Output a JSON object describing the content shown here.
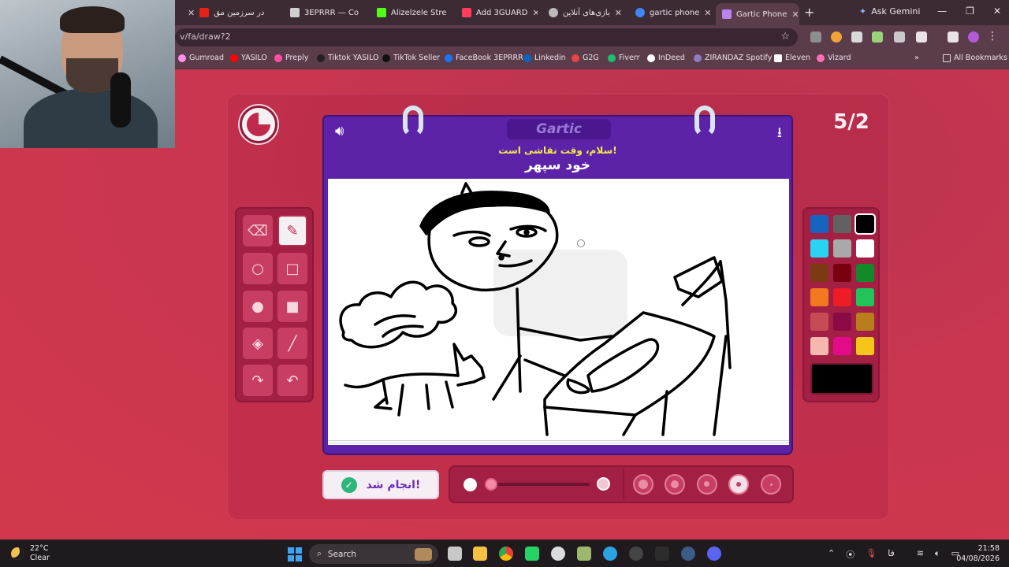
{
  "browser": {
    "tabs": [
      {
        "label": "در سرزمین مق",
        "favicon_color": "#e62117"
      },
      {
        "label": "3EPRRR — Co",
        "favicon_color": "#cfcfcf"
      },
      {
        "label": "Alizelzele Stre",
        "favicon_color": "#53fc18"
      },
      {
        "label": "Add 3GUARD",
        "favicon_color": "#ff3d5a"
      },
      {
        "label": "بازی‌های آنلاین",
        "favicon_color": "#bbbbbb"
      },
      {
        "label": "gartic phone",
        "favicon_color": "#4285f4"
      },
      {
        "label": "Gartic Phone",
        "favicon_color": "#b784f0",
        "active": true
      }
    ],
    "new_tab": "+",
    "ask_gemini": "Ask Gemini",
    "url": "v/fa/draw?2",
    "bookmarks": [
      {
        "label": "Gumroad",
        "color": "#ff90e8"
      },
      {
        "label": "YASILO",
        "color": "#ff0000"
      },
      {
        "label": "Preply",
        "color": "#ff4fa3"
      },
      {
        "label": "Tiktok YASILO",
        "color": "#222222"
      },
      {
        "label": "TikTok Seller",
        "color": "#111111"
      },
      {
        "label": "FaceBook 3EPRRR",
        "color": "#1877f2"
      },
      {
        "label": "Linkedin",
        "color": "#0a66c2"
      },
      {
        "label": "G2G",
        "color": "#e94343"
      },
      {
        "label": "Fiverr",
        "color": "#1dbf73"
      },
      {
        "label": "InDeed",
        "color": "#ffffff"
      },
      {
        "label": "ZIRANDAZ Spotify",
        "color": "#8e7cc3"
      },
      {
        "label": "Eleven",
        "color": "#ffffff"
      },
      {
        "label": "Vizard",
        "color": "#ff6fb5"
      }
    ],
    "all_bookmarks": "All Bookmarks"
  },
  "game": {
    "brand": "Gartic",
    "round": "5/2",
    "prompt_sub": "سلام، وقت نقاشی است!",
    "prompt_main": "خود سپهر",
    "done_label": "انجام شد!",
    "palette": [
      "#1565c0",
      "#616161",
      "#000000",
      "#29d3f2",
      "#a9a9a9",
      "#ffffff",
      "#7a3b12",
      "#7a0010",
      "#128a2a",
      "#f2791f",
      "#ee1c24",
      "#22c45a",
      "#c74b55",
      "#8a0a46",
      "#b97d1c",
      "#f5b7b0",
      "#e40b8a",
      "#f5c518"
    ],
    "selected_color": "#000000",
    "tools": [
      "eraser",
      "pencil",
      "circle-outline",
      "square-outline",
      "circle-filled",
      "square-filled",
      "fill-bucket",
      "line",
      "redo",
      "undo"
    ],
    "active_tool": "pencil"
  },
  "taskbar": {
    "temp": "22°C",
    "condition": "Clear",
    "search": "Search",
    "time": "21:58",
    "date": "04/08/2026",
    "lang": "فا"
  }
}
